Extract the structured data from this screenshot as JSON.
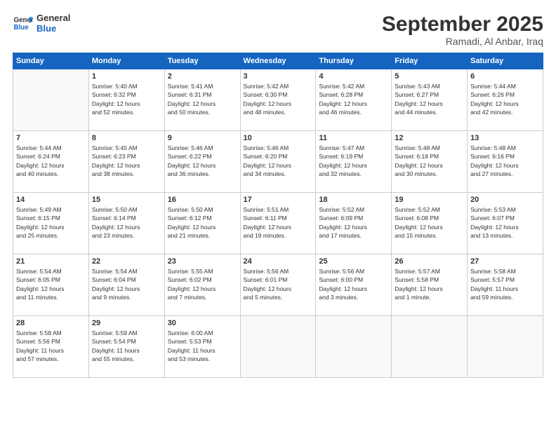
{
  "logo": {
    "line1": "General",
    "line2": "Blue"
  },
  "title": "September 2025",
  "subtitle": "Ramadi, Al Anbar, Iraq",
  "headers": [
    "Sunday",
    "Monday",
    "Tuesday",
    "Wednesday",
    "Thursday",
    "Friday",
    "Saturday"
  ],
  "weeks": [
    [
      {
        "day": "",
        "info": ""
      },
      {
        "day": "1",
        "info": "Sunrise: 5:40 AM\nSunset: 6:32 PM\nDaylight: 12 hours\nand 52 minutes."
      },
      {
        "day": "2",
        "info": "Sunrise: 5:41 AM\nSunset: 6:31 PM\nDaylight: 12 hours\nand 50 minutes."
      },
      {
        "day": "3",
        "info": "Sunrise: 5:42 AM\nSunset: 6:30 PM\nDaylight: 12 hours\nand 48 minutes."
      },
      {
        "day": "4",
        "info": "Sunrise: 5:42 AM\nSunset: 6:28 PM\nDaylight: 12 hours\nand 46 minutes."
      },
      {
        "day": "5",
        "info": "Sunrise: 5:43 AM\nSunset: 6:27 PM\nDaylight: 12 hours\nand 44 minutes."
      },
      {
        "day": "6",
        "info": "Sunrise: 5:44 AM\nSunset: 6:26 PM\nDaylight: 12 hours\nand 42 minutes."
      }
    ],
    [
      {
        "day": "7",
        "info": "Sunrise: 5:44 AM\nSunset: 6:24 PM\nDaylight: 12 hours\nand 40 minutes."
      },
      {
        "day": "8",
        "info": "Sunrise: 5:45 AM\nSunset: 6:23 PM\nDaylight: 12 hours\nand 38 minutes."
      },
      {
        "day": "9",
        "info": "Sunrise: 5:46 AM\nSunset: 6:22 PM\nDaylight: 12 hours\nand 36 minutes."
      },
      {
        "day": "10",
        "info": "Sunrise: 5:46 AM\nSunset: 6:20 PM\nDaylight: 12 hours\nand 34 minutes."
      },
      {
        "day": "11",
        "info": "Sunrise: 5:47 AM\nSunset: 6:19 PM\nDaylight: 12 hours\nand 32 minutes."
      },
      {
        "day": "12",
        "info": "Sunrise: 5:48 AM\nSunset: 6:18 PM\nDaylight: 12 hours\nand 30 minutes."
      },
      {
        "day": "13",
        "info": "Sunrise: 5:48 AM\nSunset: 6:16 PM\nDaylight: 12 hours\nand 27 minutes."
      }
    ],
    [
      {
        "day": "14",
        "info": "Sunrise: 5:49 AM\nSunset: 6:15 PM\nDaylight: 12 hours\nand 25 minutes."
      },
      {
        "day": "15",
        "info": "Sunrise: 5:50 AM\nSunset: 6:14 PM\nDaylight: 12 hours\nand 23 minutes."
      },
      {
        "day": "16",
        "info": "Sunrise: 5:50 AM\nSunset: 6:12 PM\nDaylight: 12 hours\nand 21 minutes."
      },
      {
        "day": "17",
        "info": "Sunrise: 5:51 AM\nSunset: 6:11 PM\nDaylight: 12 hours\nand 19 minutes."
      },
      {
        "day": "18",
        "info": "Sunrise: 5:52 AM\nSunset: 6:09 PM\nDaylight: 12 hours\nand 17 minutes."
      },
      {
        "day": "19",
        "info": "Sunrise: 5:52 AM\nSunset: 6:08 PM\nDaylight: 12 hours\nand 15 minutes."
      },
      {
        "day": "20",
        "info": "Sunrise: 5:53 AM\nSunset: 6:07 PM\nDaylight: 12 hours\nand 13 minutes."
      }
    ],
    [
      {
        "day": "21",
        "info": "Sunrise: 5:54 AM\nSunset: 6:05 PM\nDaylight: 12 hours\nand 11 minutes."
      },
      {
        "day": "22",
        "info": "Sunrise: 5:54 AM\nSunset: 6:04 PM\nDaylight: 12 hours\nand 9 minutes."
      },
      {
        "day": "23",
        "info": "Sunrise: 5:55 AM\nSunset: 6:02 PM\nDaylight: 12 hours\nand 7 minutes."
      },
      {
        "day": "24",
        "info": "Sunrise: 5:56 AM\nSunset: 6:01 PM\nDaylight: 12 hours\nand 5 minutes."
      },
      {
        "day": "25",
        "info": "Sunrise: 5:56 AM\nSunset: 6:00 PM\nDaylight: 12 hours\nand 3 minutes."
      },
      {
        "day": "26",
        "info": "Sunrise: 5:57 AM\nSunset: 5:58 PM\nDaylight: 12 hours\nand 1 minute."
      },
      {
        "day": "27",
        "info": "Sunrise: 5:58 AM\nSunset: 5:57 PM\nDaylight: 11 hours\nand 59 minutes."
      }
    ],
    [
      {
        "day": "28",
        "info": "Sunrise: 5:58 AM\nSunset: 5:56 PM\nDaylight: 11 hours\nand 57 minutes."
      },
      {
        "day": "29",
        "info": "Sunrise: 5:59 AM\nSunset: 5:54 PM\nDaylight: 11 hours\nand 55 minutes."
      },
      {
        "day": "30",
        "info": "Sunrise: 6:00 AM\nSunset: 5:53 PM\nDaylight: 11 hours\nand 53 minutes."
      },
      {
        "day": "",
        "info": ""
      },
      {
        "day": "",
        "info": ""
      },
      {
        "day": "",
        "info": ""
      },
      {
        "day": "",
        "info": ""
      }
    ]
  ]
}
